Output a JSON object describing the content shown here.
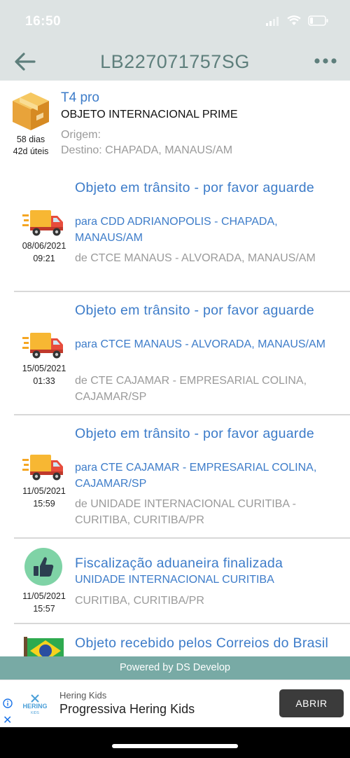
{
  "status_bar": {
    "time": "16:50"
  },
  "header": {
    "title": "LB227071757SG"
  },
  "summary": {
    "name": "T4 pro",
    "type": "OBJETO INTERNACIONAL PRIME",
    "days": "58 dias",
    "business_days": "42d úteis",
    "origin": "Origem:",
    "destination": "Destino: CHAPADA, MANAUS/AM"
  },
  "events": [
    {
      "icon": "truck-icon",
      "date": "08/06/2021",
      "time": "09:21",
      "status": "Objeto em trânsito - por favor aguarde",
      "to": "para CDD ADRIANOPOLIS - CHAPADA, MANAUS/AM",
      "from": "de CTCE MANAUS - ALVORADA, MANAUS/AM"
    },
    {
      "icon": "truck-icon",
      "date": "15/05/2021",
      "time": "01:33",
      "status": "Objeto em trânsito - por favor aguarde",
      "to": "para CTCE MANAUS - ALVORADA, MANAUS/AM",
      "from": "de CTE CAJAMAR - EMPRESARIAL COLINA, CAJAMAR/SP"
    },
    {
      "icon": "truck-icon",
      "date": "11/05/2021",
      "time": "15:59",
      "status": "Objeto em trânsito - por favor aguarde",
      "to": "para CTE CAJAMAR - EMPRESARIAL COLINA, CAJAMAR/SP",
      "from": "de UNIDADE INTERNACIONAL CURITIBA - CURITIBA, CURITIBA/PR"
    },
    {
      "icon": "thumbs-up-icon",
      "date": "11/05/2021",
      "time": "15:57",
      "status": "Fiscalização aduaneira finalizada",
      "to": "UNIDADE INTERNACIONAL CURITIBA",
      "from": "CURITIBA, CURITIBA/PR"
    },
    {
      "icon": "brazil-flag-icon",
      "status": "Objeto recebido pelos Correios do Brasil"
    }
  ],
  "footer": {
    "powered": "Powered by DS Develop"
  },
  "ad": {
    "logo_text": "HERING",
    "logo_sub": "KIDS",
    "brand": "Hering Kids",
    "headline": "Progressiva Hering Kids",
    "button": "ABRIR"
  },
  "colors": {
    "accent": "#3d7cc9",
    "header_bg": "#dde3e3",
    "footer_bg": "#78aaa5"
  }
}
